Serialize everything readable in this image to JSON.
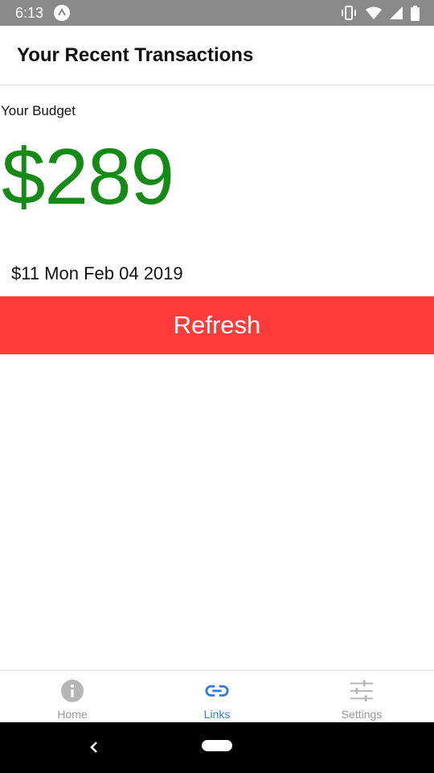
{
  "status_bar": {
    "time": "6:13",
    "icons": [
      "expo-icon",
      "vibrate-icon",
      "wifi-icon",
      "signal-icon",
      "battery-icon"
    ]
  },
  "header": {
    "title": "Your Recent Transactions"
  },
  "budget": {
    "label": "Your Budget",
    "amount": "$289",
    "amount_color": "#168a16"
  },
  "transactions": [
    {
      "text": "$11 Mon Feb 04 2019"
    }
  ],
  "refresh_button": {
    "label": "Refresh",
    "color": "#ff3b3b"
  },
  "tabs": [
    {
      "label": "Home",
      "icon": "info-icon",
      "active": false
    },
    {
      "label": "Links",
      "icon": "link-icon",
      "active": true
    },
    {
      "label": "Settings",
      "icon": "sliders-icon",
      "active": false
    }
  ],
  "colors": {
    "active_tab": "#2f7fd8",
    "inactive_tab": "#999999"
  },
  "nav_bar": {
    "icons": [
      "back-icon",
      "home-pill-icon"
    ]
  }
}
